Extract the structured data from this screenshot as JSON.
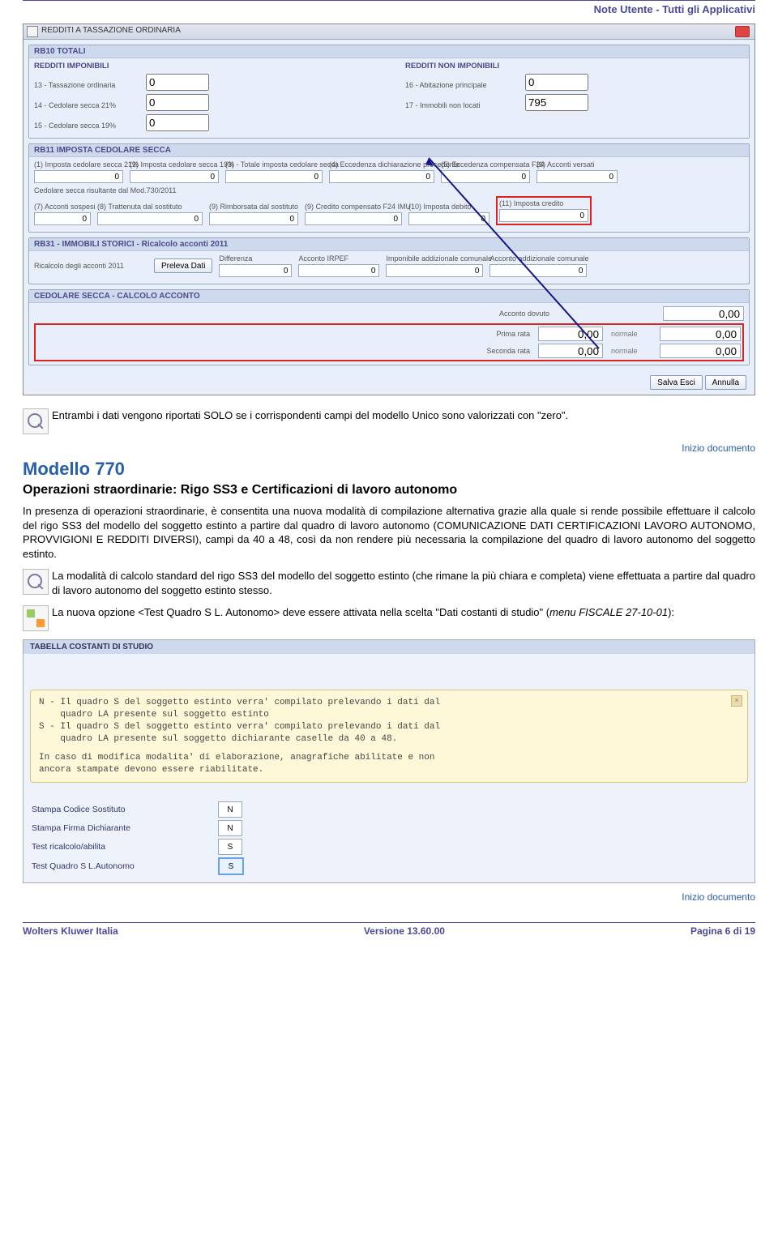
{
  "header": {
    "title": "Note Utente - Tutti gli Applicativi"
  },
  "screenshot1": {
    "windowTitle": "REDDITI A TASSAZIONE ORDINARIA",
    "rb10": {
      "title": "RB10 TOTALI",
      "col1_title": "REDDITI IMPONIBILI",
      "col2_title": "REDDITI NON IMPONIBILI",
      "r13_label": "13 - Tassazione ordinaria",
      "r13_val": "0",
      "r14_label": "14 - Cedolare secca 21%",
      "r14_val": "0",
      "r15_label": "15 - Cedolare secca 19%",
      "r15_val": "0",
      "r16_label": "16 - Abitazione principale",
      "r16_val": "0",
      "r17_label": "17 - Immobili non locati",
      "r17_val": "795"
    },
    "rb11": {
      "title": "RB11 IMPOSTA CEDOLARE SECCA",
      "c1_label": "(1) Imposta cedolare secca 21%",
      "c1_val": "0",
      "c2_label": "(2) Imposta cedolare secca 19%",
      "c2_val": "0",
      "c3_label": "(3) - Totale imposta cedolare secca",
      "c3_val": "0",
      "c4_label": "(4) Eccedenza dichiarazione precedente",
      "c4_val": "0",
      "c5_label": "(5) Eccedenza compensata F24",
      "c5_val": "0",
      "c6_label": "(6) Acconti versati",
      "c6_val": "0",
      "row2_intro": "Cedolare secca risultante dal Mod.730/2011",
      "c7_label": "(7) Acconti sospesi",
      "c7_val": "0",
      "c8_label": "(8) Trattenuta dal sostituto",
      "c8_val": "0",
      "c9a_label": "(9) Rimborsata dal sostituto",
      "c9a_val": "0",
      "c9b_label": "(9) Credito compensato F24 IMU",
      "c9b_val": "0",
      "c10_label": "(10) Imposta debito",
      "c10_val": "0",
      "c11_label": "(11) Imposta credito",
      "c11_val": "0"
    },
    "rb31": {
      "title": "RB31 - IMMOBILI STORICI - Ricalcolo acconti 2011",
      "ric_label": "Ricalcolo degli acconti 2011",
      "btn": "Preleva Dati",
      "diff_label": "Differenza",
      "diff_val": "0",
      "irpef_label": "Acconto IRPEF",
      "irpef_val": "0",
      "impadd_label": "Imponibile addizionale comunale",
      "impadd_val": "0",
      "accadd_label": "Acconto addizionale comunale",
      "accadd_val": "0"
    },
    "acconto": {
      "title": "CEDOLARE SECCA - CALCOLO ACCONTO",
      "r1_label": "Acconto dovuto",
      "r1_val": "0,00",
      "r2_label": "Prima rata",
      "r2_val": "0,00",
      "r2_note": "normale",
      "r2_side": "0,00",
      "r3_label": "Seconda rata",
      "r3_val": "0,00",
      "r3_note": "normale",
      "r3_side": "0,00"
    },
    "footer": {
      "save": "Salva Esci",
      "cancel": "Annulla"
    }
  },
  "note1": "Entrambi i dati vengono riportati SOLO se i corrispondenti campi del modello Unico sono valorizzati con \"zero\".",
  "inizio": "Inizio documento",
  "section770": {
    "title": "Modello 770",
    "subtitle": "Operazioni straordinarie: Rigo SS3 e Certificazioni di lavoro autonomo",
    "para": "In presenza di operazioni straordinarie, è consentita una nuova modalità di compilazione alternativa grazie alla quale si rende possibile effettuare il calcolo del rigo SS3 del modello del soggetto estinto a partire dal quadro di lavoro autonomo (COMUNICAZIONE DATI CERTIFICAZIONI LAVORO AUTONOMO, PROVVIGIONI E REDDITI DIVERSI), campi da 40 a 48, così da non rendere più necessaria la compilazione del quadro di lavoro autonomo del soggetto estinto.",
    "note2": "La modalità di calcolo standard del rigo SS3 del modello del soggetto estinto (che rimane la più chiara e completa) viene effettuata a partire dal quadro di lavoro autonomo del soggetto estinto stesso.",
    "note3_a": "La nuova opzione <Test Quadro S L. Autonomo> deve essere attivata nella scelta \"Dati costanti di studio\" (",
    "note3_b": "menu FISCALE  27-10-01",
    "note3_c": "):"
  },
  "screenshot2": {
    "bar": "TABELLA COSTANTI DI STUDIO",
    "tip_l1": "N - Il quadro S del soggetto estinto verra' compilato prelevando i dati dal",
    "tip_l2": "    quadro LA presente sul soggetto estinto",
    "tip_l3": "S - Il quadro S del soggetto estinto verra' compilato prelevando i dati dal",
    "tip_l4": "    quadro LA presente sul soggetto dichiarante caselle da 40 a 48.",
    "tip_l5": "",
    "tip_l6": "In caso di modifica modalita' di elaborazione, anagrafiche abilitate e non",
    "tip_l7": "ancora stampate devono essere riabilitate.",
    "opt1_label": "Stampa Codice Sostituto",
    "opt1_val": "N",
    "opt2_label": "Stampa Firma Dichiarante",
    "opt2_val": "N",
    "opt3_label": "Test ricalcolo/abilita",
    "opt3_val": "S",
    "opt4_label": "Test Quadro S L.Autonomo",
    "opt4_val": "S"
  },
  "footer": {
    "left": "Wolters Kluwer Italia",
    "mid": "Versione  13.60.00",
    "right": "Pagina  6 di 19"
  }
}
